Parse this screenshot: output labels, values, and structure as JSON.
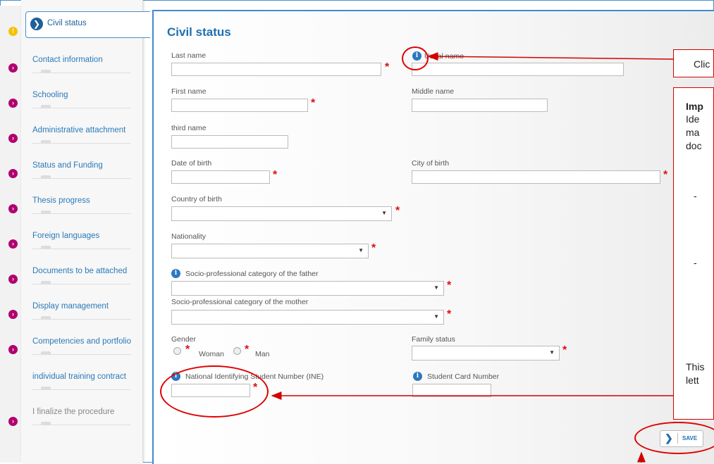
{
  "sidebar": {
    "active": "Civil status",
    "items": [
      {
        "label": "Contact information"
      },
      {
        "label": "Schooling"
      },
      {
        "label": "Administrative attachment"
      },
      {
        "label": "Status and Funding"
      },
      {
        "label": "Thesis progress"
      },
      {
        "label": "Foreign languages"
      },
      {
        "label": "Documents to be attached"
      },
      {
        "label": "Display management"
      },
      {
        "label": "Competencies and portfolio"
      },
      {
        "label": "individual training contract"
      },
      {
        "label": "I finalize the procedure"
      }
    ]
  },
  "form": {
    "title": "Civil status",
    "last_name": "Last name",
    "usual_name": "Usual name",
    "first_name": "First name",
    "middle_name": "Middle name",
    "third_name": "third name",
    "date_of_birth": "Date of birth",
    "city_of_birth": "City of birth",
    "country_of_birth": "Country of birth",
    "nationality": "Nationality",
    "father_category": "Socio-professional category of the father",
    "mother_category": "Socio-professional category of the mother",
    "gender": "Gender",
    "woman": "Woman",
    "man": "Man",
    "family_status": "Family status",
    "ine": "National Identifying Student Number (INE)",
    "student_card": "Student Card Number",
    "save": "SAVE",
    "required_mark": "*",
    "info_glyph": "i",
    "select_arrow": "▼",
    "chevron": "❯"
  },
  "annotations": {
    "callout_top": "Clic",
    "callout_main": {
      "line1": "Imp",
      "line2": "Ide",
      "line3": "ma",
      "line4": "doc",
      "dash1": "-",
      "dash2": "-",
      "line5": "This",
      "line6": "lett"
    }
  },
  "colors": {
    "accent": "#1f6fb0",
    "required": "#e01010",
    "annotation": "#d40000",
    "status_dot": "#b0006f",
    "status_warn": "#f2c200"
  }
}
